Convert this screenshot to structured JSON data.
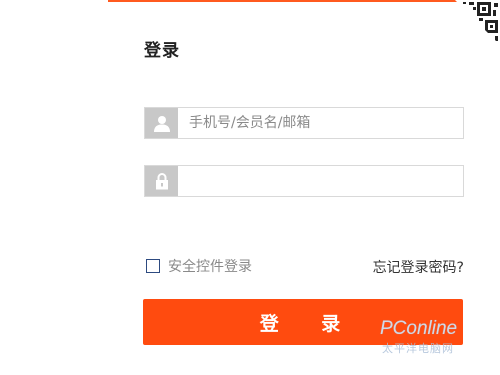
{
  "login": {
    "title": "登录",
    "username_placeholder": "手机号/会员名/邮箱",
    "password_placeholder": "",
    "auto_login_label": "安全控件登录",
    "forgot_link": "忘记登录密码?",
    "submit_label": "登 录"
  },
  "icons": {
    "user": "user-icon",
    "lock": "lock-icon",
    "qr": "qr-code-icon"
  },
  "watermark": {
    "brand": "PConline",
    "sub": "太平洋电脑网"
  },
  "colors": {
    "accent": "#ff4b0f",
    "icon_bg": "#c8c8c8",
    "border": "#d9d9d9"
  }
}
